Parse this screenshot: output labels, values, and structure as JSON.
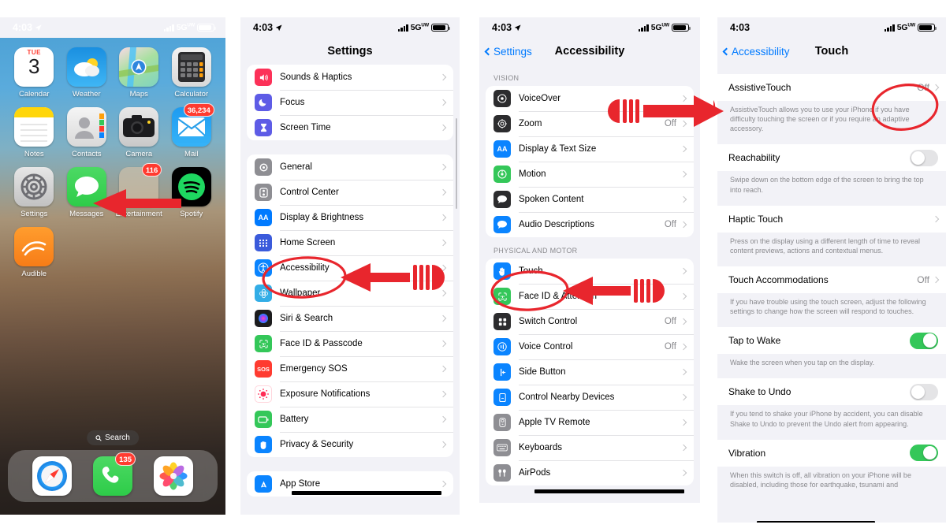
{
  "meta": {
    "accent_blue": "#007aff",
    "annotation_red": "#e8262d",
    "green": "#34c759",
    "gray_text": "#8a8a8e"
  },
  "panels": {
    "home": {
      "status": {
        "time": "4:03",
        "network": "5G",
        "network_sup": "UW",
        "location_icon": "location-arrow-icon"
      },
      "apps_row1": [
        {
          "name": "Calendar",
          "icon": "calendar-icon",
          "weekday": "TUE",
          "day": "3"
        },
        {
          "name": "Weather",
          "icon": "weather-icon"
        },
        {
          "name": "Maps",
          "icon": "maps-icon"
        },
        {
          "name": "Calculator",
          "icon": "calculator-icon"
        }
      ],
      "apps_row2": [
        {
          "name": "Notes",
          "icon": "notes-icon"
        },
        {
          "name": "Contacts",
          "icon": "contacts-icon"
        },
        {
          "name": "Camera",
          "icon": "camera-icon"
        },
        {
          "name": "Mail",
          "icon": "mail-icon",
          "badge": "36,234"
        }
      ],
      "apps_row3": [
        {
          "name": "Settings",
          "icon": "settings-gear-icon"
        },
        {
          "name": "Messages",
          "icon": "messages-icon"
        },
        {
          "name": "Entertainment",
          "icon": "folder-icon",
          "badge": "116"
        },
        {
          "name": "Spotify",
          "icon": "spotify-icon"
        }
      ],
      "apps_row4": [
        {
          "name": "Audible",
          "icon": "audible-icon"
        }
      ],
      "search": {
        "label": "Search",
        "icon": "search-icon"
      },
      "dock": [
        {
          "name": "Safari",
          "icon": "safari-icon"
        },
        {
          "name": "Phone",
          "icon": "phone-icon",
          "badge": "135"
        },
        {
          "name": "Photos",
          "icon": "photos-icon"
        }
      ]
    },
    "settings": {
      "status": {
        "time": "4:03",
        "network": "5G",
        "network_sup": "UW"
      },
      "title": "Settings",
      "group1": [
        {
          "label": "Sounds & Haptics",
          "icon": "speaker-icon",
          "color": "#fc3158"
        },
        {
          "label": "Focus",
          "icon": "moon-icon",
          "color": "#5e5ce6"
        },
        {
          "label": "Screen Time",
          "icon": "hourglass-icon",
          "color": "#5e5ce6"
        }
      ],
      "group2": [
        {
          "label": "General",
          "icon": "gear-icon",
          "color": "#8e8e93"
        },
        {
          "label": "Control Center",
          "icon": "sliders-icon",
          "color": "#8e8e93"
        },
        {
          "label": "Display & Brightness",
          "icon": "text-size-icon",
          "color": "#007aff"
        },
        {
          "label": "Home Screen",
          "icon": "home-grid-icon",
          "color": "#3b5bdb"
        },
        {
          "label": "Accessibility",
          "icon": "accessibility-person-icon",
          "color": "#0a84ff"
        },
        {
          "label": "Wallpaper",
          "icon": "wallpaper-flower-icon",
          "color": "#32ade6"
        },
        {
          "label": "Siri & Search",
          "icon": "siri-orb-icon",
          "color": "#1c1c1e"
        },
        {
          "label": "Face ID & Passcode",
          "icon": "face-id-icon",
          "color": "#34c759"
        },
        {
          "label": "Emergency SOS",
          "icon": "sos-icon",
          "color": "#ff3b30"
        },
        {
          "label": "Exposure Notifications",
          "icon": "exposure-dot-icon",
          "color": "#ff2d55"
        },
        {
          "label": "Battery",
          "icon": "battery-icon",
          "color": "#34c759"
        },
        {
          "label": "Privacy & Security",
          "icon": "hand-raised-icon",
          "color": "#0a84ff"
        }
      ],
      "group3": [
        {
          "label": "App Store",
          "icon": "app-store-icon",
          "color": "#0a84ff",
          "redacted": true
        }
      ]
    },
    "accessibility": {
      "status": {
        "time": "4:03",
        "network": "5G",
        "network_sup": "UW"
      },
      "back_label": "Settings",
      "title": "Accessibility",
      "section_vision": "VISION",
      "vision": [
        {
          "label": "VoiceOver",
          "icon": "voiceover-icon",
          "color": "#2c2c2e",
          "value": ""
        },
        {
          "label": "Zoom",
          "icon": "zoom-icon",
          "color": "#2c2c2e",
          "value": "Off"
        },
        {
          "label": "Display & Text Size",
          "icon": "text-size-icon",
          "color": "#0a84ff",
          "value": ""
        },
        {
          "label": "Motion",
          "icon": "motion-icon",
          "color": "#34c759",
          "value": ""
        },
        {
          "label": "Spoken Content",
          "icon": "spoken-content-icon",
          "color": "#2c2c2e",
          "value": ""
        },
        {
          "label": "Audio Descriptions",
          "icon": "audio-description-icon",
          "color": "#0a84ff",
          "value": "Off"
        }
      ],
      "section_physical": "PHYSICAL AND MOTOR",
      "physical": [
        {
          "label": "Touch",
          "icon": "touch-hand-icon",
          "color": "#0a84ff",
          "value": ""
        },
        {
          "label": "Face ID & Attention",
          "icon": "face-id-icon",
          "color": "#34c759",
          "value": ""
        },
        {
          "label": "Switch Control",
          "icon": "switch-control-icon",
          "color": "#2c2c2e",
          "value": "Off"
        },
        {
          "label": "Voice Control",
          "icon": "voice-control-icon",
          "color": "#0a84ff",
          "value": "Off"
        },
        {
          "label": "Side Button",
          "icon": "side-button-icon",
          "color": "#0a84ff",
          "value": ""
        },
        {
          "label": "Control Nearby Devices",
          "icon": "nearby-devices-icon",
          "color": "#0a84ff",
          "value": ""
        },
        {
          "label": "Apple TV Remote",
          "icon": "tv-remote-icon",
          "color": "#8e8e93",
          "value": ""
        },
        {
          "label": "Keyboards",
          "icon": "keyboard-icon",
          "color": "#8e8e93",
          "value": ""
        },
        {
          "label": "AirPods",
          "icon": "airpods-icon",
          "color": "#8e8e93",
          "value": "",
          "redacted": true
        }
      ]
    },
    "touch": {
      "status": {
        "time": "4:03",
        "network": "5G",
        "network_sup": "UW"
      },
      "back_label": "Accessibility",
      "title": "Touch",
      "items": [
        {
          "label": "AssistiveTouch",
          "control": "value",
          "value": "Off",
          "footnote": "AssistiveTouch allows you to use your iPhone if you have difficulty touching the screen or if you require an adaptive accessory.",
          "circled": true
        },
        {
          "label": "Reachability",
          "control": "toggle",
          "toggle_on": false,
          "footnote": "Swipe down on the bottom edge of the screen to bring the top into reach."
        },
        {
          "label": "Haptic Touch",
          "control": "chevron",
          "value": "",
          "footnote": "Press on the display using a different length of time to reveal content previews, actions and contextual menus."
        },
        {
          "label": "Touch Accommodations",
          "control": "value",
          "value": "Off",
          "footnote": "If you have trouble using the touch screen, adjust the following settings to change how the screen will respond to touches."
        },
        {
          "label": "Tap to Wake",
          "control": "toggle",
          "toggle_on": true,
          "footnote": "Wake the screen when you tap on the display."
        },
        {
          "label": "Shake to Undo",
          "control": "toggle",
          "toggle_on": false,
          "footnote": "If you tend to shake your iPhone by accident, you can disable Shake to Undo to prevent the Undo alert from appearing."
        },
        {
          "label": "Vibration",
          "control": "toggle",
          "toggle_on": true,
          "footnote": "When this switch is off, all vibration on your iPhone will be disabled, including those for earthquake, tsunami and",
          "redacted": true
        }
      ]
    }
  },
  "annotations": {
    "home_arrow": "red-arrow-pointing-left-at-settings",
    "settings_circle": "red-ellipse-around-accessibility",
    "settings_arrow": "red-arrow-pointing-left-at-accessibility",
    "accessibility_circle": "red-ellipse-around-touch",
    "accessibility_arrow_touch": "red-arrow-pointing-left-at-touch",
    "accessibility_arrow_voiceover": "red-arrow-pointing-right-to-touch-panel",
    "touch_circle": "red-ellipse-around-assistivetouch-off-value"
  }
}
